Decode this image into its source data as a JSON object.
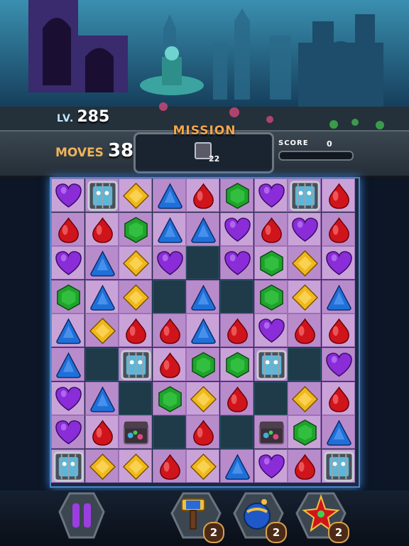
{
  "level": {
    "prefix": "LV.",
    "number": "285"
  },
  "moves": {
    "label": "MOVES",
    "value": "38"
  },
  "mission": {
    "title": "MISSION",
    "target_icon": "cage-icon",
    "target_count": "22"
  },
  "score": {
    "label": "SCORE",
    "value": "0",
    "progress": 0
  },
  "board": {
    "rows": [
      [
        "purple-heart",
        "cage",
        "yellow-diamond",
        "blue-triangle",
        "red-drop",
        "green-hex",
        "purple-heart",
        "cage",
        "red-drop"
      ],
      [
        "red-drop",
        "red-drop",
        "green-hex",
        "blue-triangle",
        "blue-triangle",
        "purple-heart",
        "red-drop",
        "purple-heart",
        "red-drop"
      ],
      [
        "purple-heart",
        "blue-triangle",
        "yellow-diamond",
        "purple-heart",
        "empty",
        "purple-heart",
        "green-hex",
        "yellow-diamond",
        "purple-heart"
      ],
      [
        "green-hex",
        "blue-triangle",
        "yellow-diamond",
        "empty",
        "blue-triangle",
        "empty",
        "green-hex",
        "yellow-diamond",
        "blue-triangle"
      ],
      [
        "blue-triangle",
        "yellow-diamond",
        "red-drop",
        "red-drop",
        "blue-triangle",
        "red-drop",
        "purple-heart",
        "red-drop",
        "red-drop"
      ],
      [
        "blue-triangle",
        "empty",
        "cage",
        "red-drop",
        "green-hex",
        "green-hex",
        "cage",
        "empty",
        "purple-heart"
      ],
      [
        "purple-heart",
        "blue-triangle",
        "empty",
        "green-hex",
        "yellow-diamond",
        "red-drop",
        "empty",
        "yellow-diamond",
        "red-drop"
      ],
      [
        "purple-heart",
        "red-drop",
        "chest",
        "empty",
        "red-drop",
        "empty",
        "chest",
        "green-hex",
        "blue-triangle"
      ],
      [
        "cage",
        "yellow-diamond",
        "yellow-diamond",
        "red-drop",
        "yellow-diamond",
        "blue-triangle",
        "purple-heart",
        "red-drop",
        "cage"
      ]
    ]
  },
  "colors": {
    "red": "#d0141c",
    "green": "#1fa32c",
    "blue": "#1f6fd8",
    "yellow": "#f0b81a",
    "purple": "#8a2cd8",
    "tile": "#c9a3d8",
    "hole": "#1f3b4a"
  },
  "powerups": [
    {
      "name": "hammer",
      "icon": "hammer-icon",
      "count": "2"
    },
    {
      "name": "bomb",
      "icon": "bomb-icon",
      "count": "2"
    },
    {
      "name": "star",
      "icon": "star-gem-icon",
      "count": "2"
    }
  ],
  "pause_icon": "pause-icon"
}
